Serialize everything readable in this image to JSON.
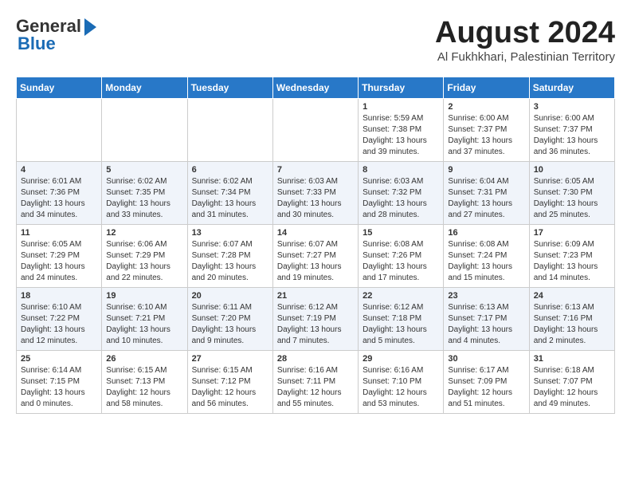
{
  "header": {
    "logo_general": "General",
    "logo_blue": "Blue",
    "month_title": "August 2024",
    "location": "Al Fukhkhari, Palestinian Territory"
  },
  "weekdays": [
    "Sunday",
    "Monday",
    "Tuesday",
    "Wednesday",
    "Thursday",
    "Friday",
    "Saturday"
  ],
  "weeks": [
    [
      {
        "day": "",
        "info": ""
      },
      {
        "day": "",
        "info": ""
      },
      {
        "day": "",
        "info": ""
      },
      {
        "day": "",
        "info": ""
      },
      {
        "day": "1",
        "info": "Sunrise: 5:59 AM\nSunset: 7:38 PM\nDaylight: 13 hours\nand 39 minutes."
      },
      {
        "day": "2",
        "info": "Sunrise: 6:00 AM\nSunset: 7:37 PM\nDaylight: 13 hours\nand 37 minutes."
      },
      {
        "day": "3",
        "info": "Sunrise: 6:00 AM\nSunset: 7:37 PM\nDaylight: 13 hours\nand 36 minutes."
      }
    ],
    [
      {
        "day": "4",
        "info": "Sunrise: 6:01 AM\nSunset: 7:36 PM\nDaylight: 13 hours\nand 34 minutes."
      },
      {
        "day": "5",
        "info": "Sunrise: 6:02 AM\nSunset: 7:35 PM\nDaylight: 13 hours\nand 33 minutes."
      },
      {
        "day": "6",
        "info": "Sunrise: 6:02 AM\nSunset: 7:34 PM\nDaylight: 13 hours\nand 31 minutes."
      },
      {
        "day": "7",
        "info": "Sunrise: 6:03 AM\nSunset: 7:33 PM\nDaylight: 13 hours\nand 30 minutes."
      },
      {
        "day": "8",
        "info": "Sunrise: 6:03 AM\nSunset: 7:32 PM\nDaylight: 13 hours\nand 28 minutes."
      },
      {
        "day": "9",
        "info": "Sunrise: 6:04 AM\nSunset: 7:31 PM\nDaylight: 13 hours\nand 27 minutes."
      },
      {
        "day": "10",
        "info": "Sunrise: 6:05 AM\nSunset: 7:30 PM\nDaylight: 13 hours\nand 25 minutes."
      }
    ],
    [
      {
        "day": "11",
        "info": "Sunrise: 6:05 AM\nSunset: 7:29 PM\nDaylight: 13 hours\nand 24 minutes."
      },
      {
        "day": "12",
        "info": "Sunrise: 6:06 AM\nSunset: 7:29 PM\nDaylight: 13 hours\nand 22 minutes."
      },
      {
        "day": "13",
        "info": "Sunrise: 6:07 AM\nSunset: 7:28 PM\nDaylight: 13 hours\nand 20 minutes."
      },
      {
        "day": "14",
        "info": "Sunrise: 6:07 AM\nSunset: 7:27 PM\nDaylight: 13 hours\nand 19 minutes."
      },
      {
        "day": "15",
        "info": "Sunrise: 6:08 AM\nSunset: 7:26 PM\nDaylight: 13 hours\nand 17 minutes."
      },
      {
        "day": "16",
        "info": "Sunrise: 6:08 AM\nSunset: 7:24 PM\nDaylight: 13 hours\nand 15 minutes."
      },
      {
        "day": "17",
        "info": "Sunrise: 6:09 AM\nSunset: 7:23 PM\nDaylight: 13 hours\nand 14 minutes."
      }
    ],
    [
      {
        "day": "18",
        "info": "Sunrise: 6:10 AM\nSunset: 7:22 PM\nDaylight: 13 hours\nand 12 minutes."
      },
      {
        "day": "19",
        "info": "Sunrise: 6:10 AM\nSunset: 7:21 PM\nDaylight: 13 hours\nand 10 minutes."
      },
      {
        "day": "20",
        "info": "Sunrise: 6:11 AM\nSunset: 7:20 PM\nDaylight: 13 hours\nand 9 minutes."
      },
      {
        "day": "21",
        "info": "Sunrise: 6:12 AM\nSunset: 7:19 PM\nDaylight: 13 hours\nand 7 minutes."
      },
      {
        "day": "22",
        "info": "Sunrise: 6:12 AM\nSunset: 7:18 PM\nDaylight: 13 hours\nand 5 minutes."
      },
      {
        "day": "23",
        "info": "Sunrise: 6:13 AM\nSunset: 7:17 PM\nDaylight: 13 hours\nand 4 minutes."
      },
      {
        "day": "24",
        "info": "Sunrise: 6:13 AM\nSunset: 7:16 PM\nDaylight: 13 hours\nand 2 minutes."
      }
    ],
    [
      {
        "day": "25",
        "info": "Sunrise: 6:14 AM\nSunset: 7:15 PM\nDaylight: 13 hours\nand 0 minutes."
      },
      {
        "day": "26",
        "info": "Sunrise: 6:15 AM\nSunset: 7:13 PM\nDaylight: 12 hours\nand 58 minutes."
      },
      {
        "day": "27",
        "info": "Sunrise: 6:15 AM\nSunset: 7:12 PM\nDaylight: 12 hours\nand 56 minutes."
      },
      {
        "day": "28",
        "info": "Sunrise: 6:16 AM\nSunset: 7:11 PM\nDaylight: 12 hours\nand 55 minutes."
      },
      {
        "day": "29",
        "info": "Sunrise: 6:16 AM\nSunset: 7:10 PM\nDaylight: 12 hours\nand 53 minutes."
      },
      {
        "day": "30",
        "info": "Sunrise: 6:17 AM\nSunset: 7:09 PM\nDaylight: 12 hours\nand 51 minutes."
      },
      {
        "day": "31",
        "info": "Sunrise: 6:18 AM\nSunset: 7:07 PM\nDaylight: 12 hours\nand 49 minutes."
      }
    ]
  ]
}
